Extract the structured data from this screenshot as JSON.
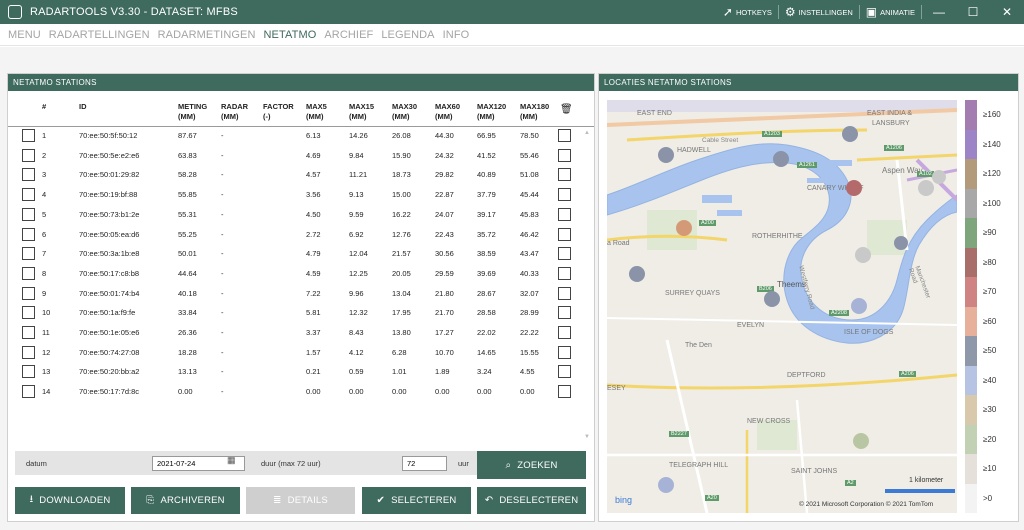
{
  "window": {
    "title": "RADARTOOLS V3.30 - DATASET: MFBS",
    "hotkeys": "HOTKEYS",
    "settings": "INSTELLINGEN",
    "animation": "ANIMATIE"
  },
  "menu": [
    "MENU",
    "RADARTELLINGEN",
    "RADARMETINGEN",
    "NETATMO",
    "ARCHIEF",
    "LEGENDA",
    "INFO"
  ],
  "menu_active": "NETATMO",
  "left_panel": {
    "title": "NETATMO STATIONS"
  },
  "table": {
    "headers": [
      {
        "l1": "#",
        "l2": ""
      },
      {
        "l1": "ID",
        "l2": ""
      },
      {
        "l1": "METING",
        "l2": "(MM)"
      },
      {
        "l1": "RADAR",
        "l2": "(MM)"
      },
      {
        "l1": "FACTOR",
        "l2": "(-)"
      },
      {
        "l1": "MAX5",
        "l2": "(MM)"
      },
      {
        "l1": "MAX15",
        "l2": "(MM)"
      },
      {
        "l1": "MAX30",
        "l2": "(MM)"
      },
      {
        "l1": "MAX60",
        "l2": "(MM)"
      },
      {
        "l1": "MAX120",
        "l2": "(MM)"
      },
      {
        "l1": "MAX180",
        "l2": "(MM)"
      }
    ],
    "rows": [
      [
        "1",
        "70:ee:50:5f:50:12",
        "87.67",
        "-",
        "",
        "6.13",
        "14.26",
        "26.08",
        "44.30",
        "66.95",
        "78.50"
      ],
      [
        "2",
        "70:ee:50:5e:e2:e6",
        "63.83",
        "-",
        "",
        "4.69",
        "9.84",
        "15.90",
        "24.32",
        "41.52",
        "55.46"
      ],
      [
        "3",
        "70:ee:50:01:29:82",
        "58.28",
        "-",
        "",
        "4.57",
        "11.21",
        "18.73",
        "29.82",
        "40.89",
        "51.08"
      ],
      [
        "4",
        "70:ee:50:19:bf:88",
        "55.85",
        "-",
        "",
        "3.56",
        "9.13",
        "15.00",
        "22.87",
        "37.79",
        "45.44"
      ],
      [
        "5",
        "70:ee:50:73:b1:2e",
        "55.31",
        "-",
        "",
        "4.50",
        "9.59",
        "16.22",
        "24.07",
        "39.17",
        "45.83"
      ],
      [
        "6",
        "70:ee:50:05:ea:d6",
        "55.25",
        "-",
        "",
        "2.72",
        "6.92",
        "12.76",
        "22.43",
        "35.72",
        "46.42"
      ],
      [
        "7",
        "70:ee:50:3a:1b:e8",
        "50.01",
        "-",
        "",
        "4.79",
        "12.04",
        "21.57",
        "30.56",
        "38.59",
        "43.47"
      ],
      [
        "8",
        "70:ee:50:17:c8:b8",
        "44.64",
        "-",
        "",
        "4.59",
        "12.25",
        "20.05",
        "29.59",
        "39.69",
        "40.33"
      ],
      [
        "9",
        "70:ee:50:01:74:b4",
        "40.18",
        "-",
        "",
        "7.22",
        "9.96",
        "13.04",
        "21.80",
        "28.67",
        "32.07"
      ],
      [
        "10",
        "70:ee:50:1a:f9:fe",
        "33.84",
        "-",
        "",
        "5.81",
        "12.32",
        "17.95",
        "21.70",
        "28.58",
        "28.99"
      ],
      [
        "11",
        "70:ee:50:1e:05:e6",
        "26.36",
        "-",
        "",
        "3.37",
        "8.43",
        "13.80",
        "17.27",
        "22.02",
        "22.22"
      ],
      [
        "12",
        "70:ee:50:74:27:08",
        "18.28",
        "-",
        "",
        "1.57",
        "4.12",
        "6.28",
        "10.70",
        "14.65",
        "15.55"
      ],
      [
        "13",
        "70:ee:50:20:bb:a2",
        "13.13",
        "-",
        "",
        "0.21",
        "0.59",
        "1.01",
        "1.89",
        "3.24",
        "4.55"
      ],
      [
        "14",
        "70:ee:50:17:7d:8c",
        "0.00",
        "-",
        "",
        "0.00",
        "0.00",
        "0.00",
        "0.00",
        "0.00",
        "0.00"
      ]
    ]
  },
  "form": {
    "datum_label": "datum",
    "datum_value": "2021-07-24",
    "duur_label": "duur (max 72 uur)",
    "duur_value": "72",
    "uur_label": "uur"
  },
  "buttons": {
    "zoeken": "ZOEKEN",
    "downloaden": "DOWNLOADEN",
    "archiveren": "ARCHIVEREN",
    "details": "DETAILS",
    "selecteren": "SELECTEREN",
    "deselecteren": "DESELECTEREN"
  },
  "right_panel": {
    "title": "LOCATIES NETATMO STATIONS"
  },
  "map_labels": {
    "east_end": "EAST END",
    "shadwell": "HADWELL",
    "east_india": "EAST INDIA &",
    "lansbury": "LANSBURY",
    "cable_street": "Cable Street",
    "aspen_way": "Aspen Way",
    "canary_wharf": "CANARY WHARF",
    "rotherhithe": "ROTHERHITHE",
    "surrey_quays": "SURREY QUAYS",
    "thames": "Theems",
    "westferry": "Westferry Road",
    "manchester": "Manchester Road",
    "isle_of_dogs": "ISLE OF DOGS",
    "evelyn": "EVELYN",
    "the_den": "The Den",
    "deptford": "DEPTFORD",
    "new_cross": "NEW CROSS",
    "telegraph_hill": "TELEGRAPH HILL",
    "saint_johns": "SAINT JOHNS",
    "a_road": "a Road",
    "esey": "ESEY",
    "a1203": "A1203",
    "a1206": "A1206",
    "a1261": "A1261",
    "a102": "A102",
    "a200": "A200",
    "a206": "A206",
    "a2": "A2",
    "a2208": "A2208",
    "a20": "A20",
    "b2227": "B2227",
    "b206": "B206"
  },
  "map_stations": [
    {
      "color": "#8a93a8"
    },
    {
      "color": "#8a93a8"
    },
    {
      "color": "#8a93a8"
    },
    {
      "color": "#b46a6a"
    },
    {
      "color": "#c9c9c9"
    },
    {
      "color": "#d49a78"
    },
    {
      "color": "#8a93a8"
    },
    {
      "color": "#c9c9c9"
    },
    {
      "color": "#8a93a8"
    },
    {
      "color": "#a7b3d6"
    },
    {
      "color": "#8a93a8"
    },
    {
      "color": "#b9c6a4"
    },
    {
      "color": "#a7b3d6"
    },
    {
      "color": "#c9c9c9"
    }
  ],
  "legend": [
    {
      "label": "≥160",
      "color": "#a47db0"
    },
    {
      "label": "≥140",
      "color": "#9c84c6"
    },
    {
      "label": "≥120",
      "color": "#b39a7a"
    },
    {
      "label": "≥100",
      "color": "#a8a8a8"
    },
    {
      "label": "≥90",
      "color": "#7fa57c"
    },
    {
      "label": "≥80",
      "color": "#a86e6a"
    },
    {
      "label": "≥70",
      "color": "#cf8383"
    },
    {
      "label": "≥60",
      "color": "#e6b09a"
    },
    {
      "label": "≥50",
      "color": "#8f98a8"
    },
    {
      "label": "≥40",
      "color": "#b6c3e3"
    },
    {
      "label": "≥30",
      "color": "#d8c9ad"
    },
    {
      "label": "≥20",
      "color": "#c2d1b4"
    },
    {
      "label": "≥10",
      "color": "#e5e1da"
    },
    {
      "label": ">0",
      "color": "#f3f3f3"
    }
  ],
  "map_footer": {
    "scale": "1 kilometer",
    "copyright": "© 2021 Microsoft Corporation   © 2021 TomTom",
    "bing": "bing"
  }
}
